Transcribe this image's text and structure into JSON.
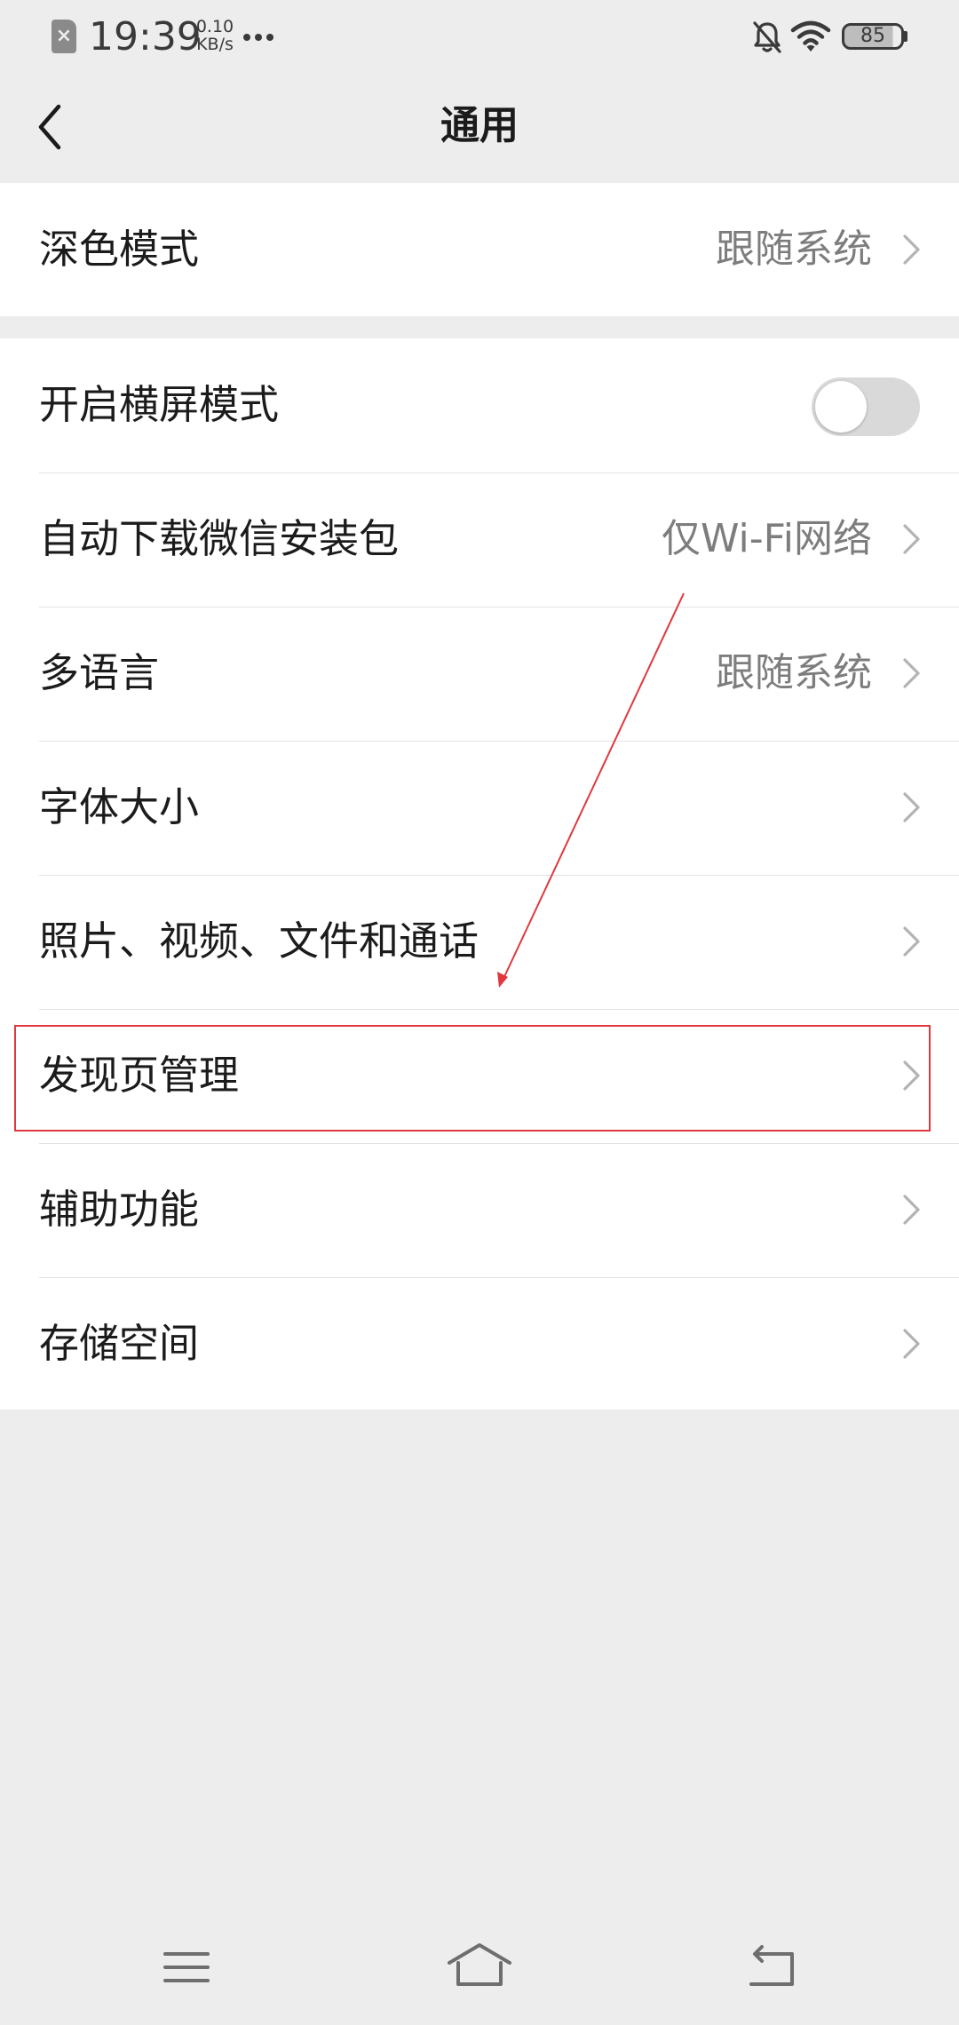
{
  "status_bar": {
    "time": "19:39",
    "net_speed_value": "0.10",
    "net_speed_unit": "KB/s",
    "battery_level": "85",
    "icons": [
      "sim-error-icon",
      "more-dots-icon",
      "bell-muted-icon",
      "wifi-icon",
      "battery-icon"
    ]
  },
  "nav": {
    "title": "通用",
    "back_icon": "chevron-left-icon"
  },
  "settings": {
    "dark_mode": {
      "label": "深色模式",
      "value": "跟随系统"
    },
    "landscape": {
      "label": "开启横屏模式",
      "enabled": false
    },
    "auto_download": {
      "label": "自动下载微信安装包",
      "value": "仅Wi-Fi网络"
    },
    "language": {
      "label": "多语言",
      "value": "跟随系统"
    },
    "font_size": {
      "label": "字体大小"
    },
    "media": {
      "label": "照片、视频、文件和通话"
    },
    "discover": {
      "label": "发现页管理"
    },
    "accessibility": {
      "label": "辅助功能"
    },
    "storage": {
      "label": "存储空间"
    }
  },
  "annotation": {
    "highlight_target": "发现页管理",
    "color": "#e0383e"
  },
  "bottom_nav": {
    "icons": [
      "menu-icon",
      "home-icon",
      "back-return-icon"
    ]
  },
  "colors": {
    "background": "#ededed",
    "card": "#ffffff",
    "text_primary": "#1b1b1b",
    "text_secondary": "#7d7d7d",
    "toggle_off": "#d9d9d9"
  }
}
